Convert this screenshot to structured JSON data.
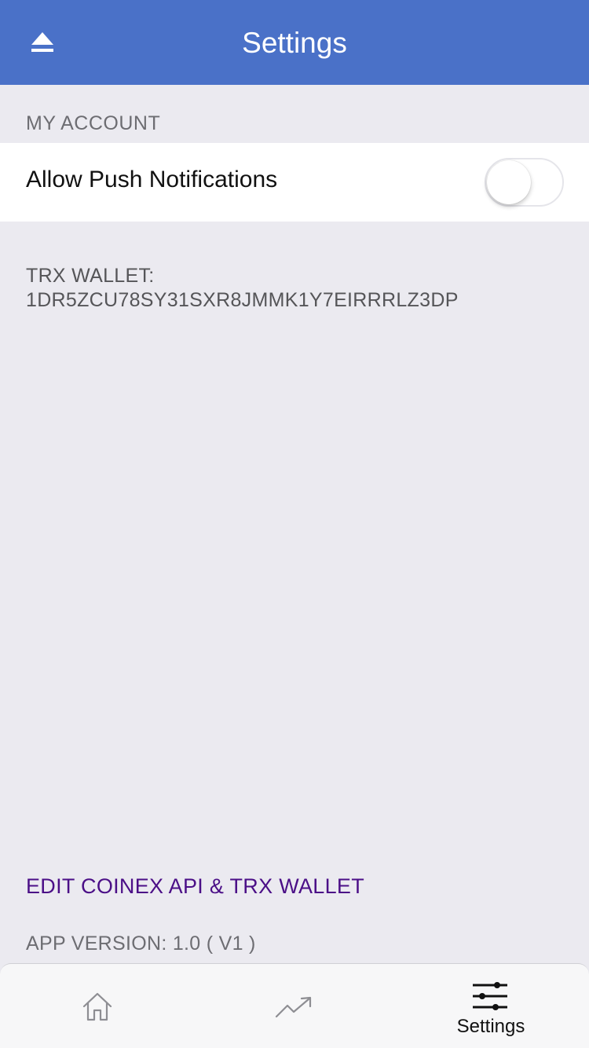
{
  "colors": {
    "nav_background": "#4a71c8",
    "screen_background": "#ebeaf0",
    "link_color": "#4b0f87"
  },
  "navbar": {
    "title": "Settings",
    "left_icon": "eject-icon"
  },
  "account_section": {
    "header": "MY ACCOUNT",
    "push_notifications": {
      "label": "Allow Push Notifications",
      "enabled": false
    }
  },
  "wallet": {
    "label": "TRX WALLET:",
    "address": "1DR5ZCU78SY31SXR8JMMK1Y7EIRRRLZ3DP"
  },
  "edit_link": "EDIT COINEX API & TRX WALLET",
  "app_version": "APP VERSION: 1.0 ( V1 )",
  "tabbar": {
    "tabs": [
      {
        "icon": "home-icon",
        "label": "",
        "active": false
      },
      {
        "icon": "trending-chart-icon",
        "label": "",
        "active": false
      },
      {
        "icon": "sliders-icon",
        "label": "Settings",
        "active": true
      }
    ]
  }
}
